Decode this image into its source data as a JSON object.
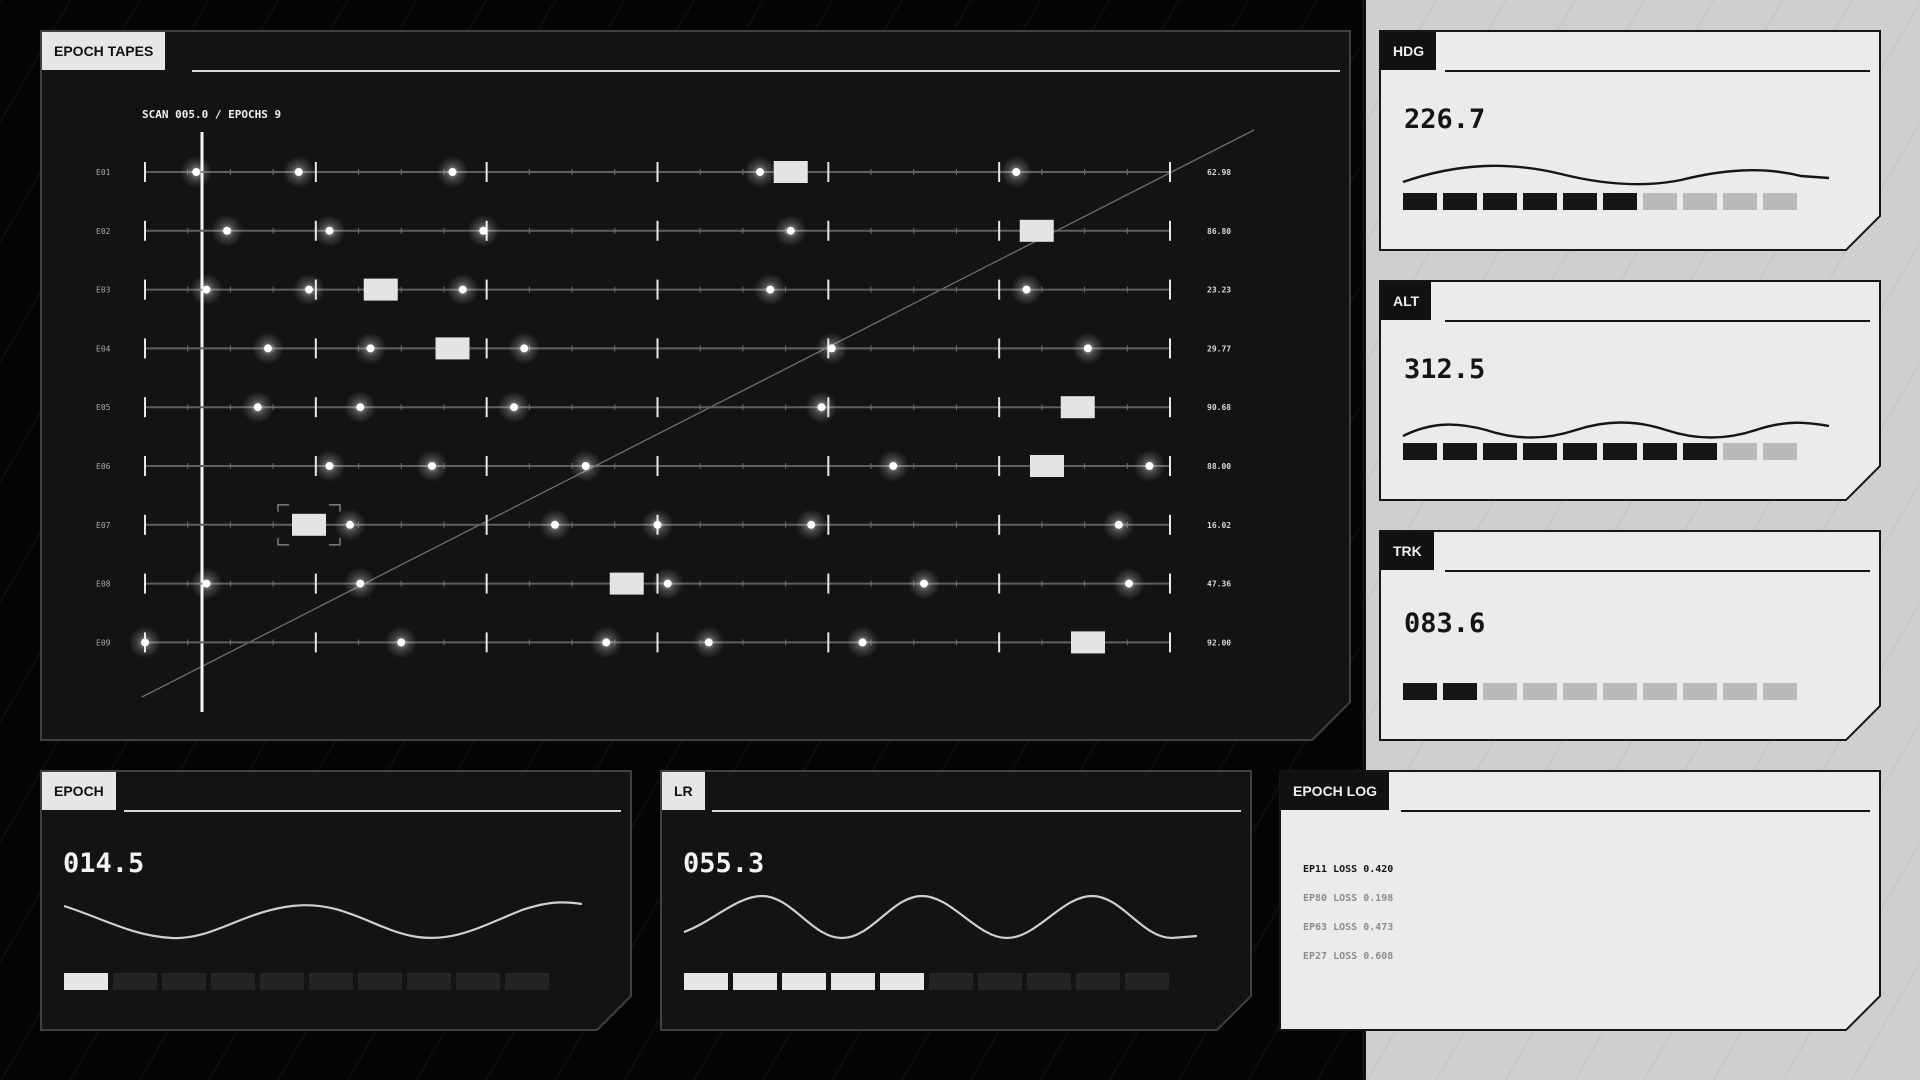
{
  "tapes": {
    "title": "EPOCH TAPES",
    "scan_label": "SCAN 005.0 / EPOCHS 9",
    "rows": [
      {
        "label": "E01",
        "value": "62.98",
        "dots": [
          0.05,
          0.15,
          0.3,
          0.6,
          0.85
        ],
        "block": 0.63
      },
      {
        "label": "E02",
        "value": "86.80",
        "dots": [
          0.08,
          0.18,
          0.33,
          0.63
        ],
        "block": 0.87
      },
      {
        "label": "E03",
        "value": "23.23",
        "dots": [
          0.06,
          0.16,
          0.31,
          0.61,
          0.86
        ],
        "block": 0.23
      },
      {
        "label": "E04",
        "value": "29.77",
        "dots": [
          0.12,
          0.22,
          0.37,
          0.67,
          0.92
        ],
        "block": 0.3
      },
      {
        "label": "E05",
        "value": "90.68",
        "dots": [
          0.11,
          0.21,
          0.36,
          0.66
        ],
        "block": 0.91
      },
      {
        "label": "E06",
        "value": "88.00",
        "dots": [
          0.18,
          0.28,
          0.43,
          0.73,
          0.98
        ],
        "block": 0.88
      },
      {
        "label": "E07",
        "value": "16.02",
        "dots": [
          0.2,
          0.4,
          0.5,
          0.65,
          0.95
        ],
        "block": 0.16
      },
      {
        "label": "E08",
        "value": "47.36",
        "dots": [
          0.06,
          0.21,
          0.51,
          0.76,
          0.96
        ],
        "block": 0.47
      },
      {
        "label": "E09",
        "value": "92.00",
        "dots": [
          0.0,
          0.25,
          0.45,
          0.55,
          0.7
        ],
        "block": 0.92
      }
    ]
  },
  "gauges": [
    {
      "label": "HDG",
      "value": "226.7",
      "segments_on": 6,
      "segments_total": 10,
      "has_wave": true
    },
    {
      "label": "ALT",
      "value": "312.5",
      "segments_on": 8,
      "segments_total": 10,
      "has_wave": true
    },
    {
      "label": "TRK",
      "value": "083.6",
      "segments_on": 2,
      "segments_total": 10,
      "has_wave": false
    }
  ],
  "epoch": {
    "label": "EPOCH",
    "value": "014.5",
    "segments_on": 1,
    "segments_total": 10
  },
  "lr": {
    "label": "LR",
    "value": "055.3",
    "segments_on": 5,
    "segments_total": 10
  },
  "log": {
    "title": "EPOCH LOG",
    "lines": [
      {
        "ep": "EP11",
        "loss_label": "LOSS",
        "loss": "0.420"
      },
      {
        "ep": "EP80",
        "loss_label": "LOSS",
        "loss": "0.198"
      },
      {
        "ep": "EP63",
        "loss_label": "LOSS",
        "loss": "0.473"
      },
      {
        "ep": "EP27",
        "loss_label": "LOSS",
        "loss": "0.608"
      }
    ]
  },
  "colors": {
    "dark_bg": "#121312",
    "light_bg": "#ebecea",
    "ink": "#151515",
    "accent_light": "#e6e7e5"
  }
}
